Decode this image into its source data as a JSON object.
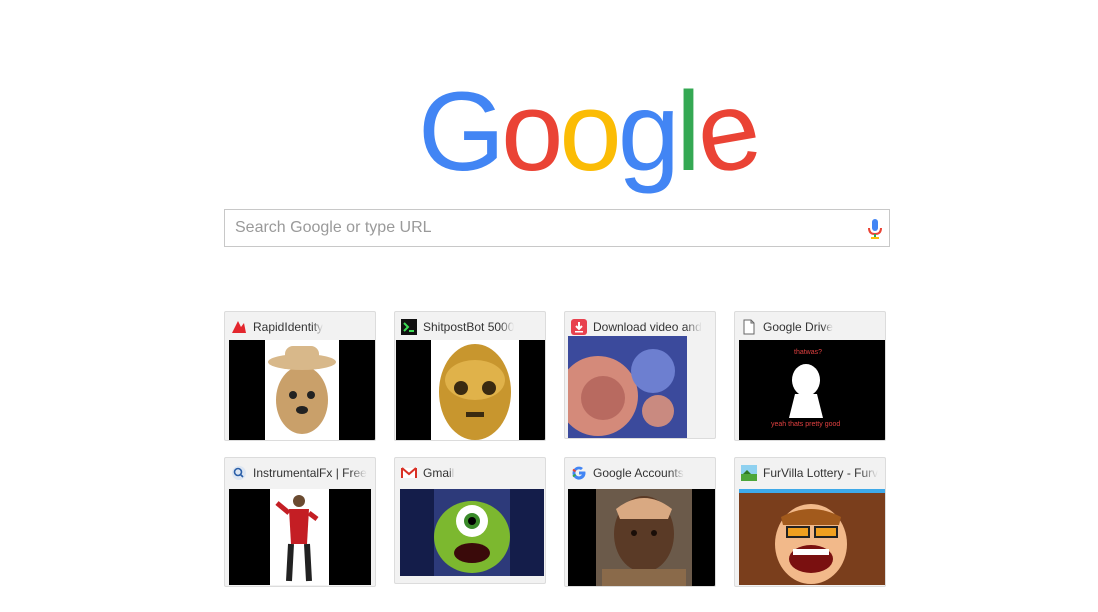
{
  "logo": {
    "letters": [
      "G",
      "o",
      "o",
      "g",
      "l",
      "e"
    ],
    "colors": [
      "#4285F4",
      "#EA4335",
      "#FBBC05",
      "#4285F4",
      "#34A853",
      "#EA4335"
    ]
  },
  "search": {
    "placeholder": "Search Google or type URL",
    "value": "",
    "mic_icon": "microphone-icon"
  },
  "tiles": [
    {
      "title": "RapidIdentity",
      "favicon": "rapididentity-favicon-icon",
      "thumbnail": "dog-in-cowboy-hat"
    },
    {
      "title": "ShitpostBot 5000",
      "favicon": "terminal-favicon-icon",
      "thumbnail": "gold-robot-face"
    },
    {
      "title": "Download video and",
      "favicon": "download-favicon-icon",
      "thumbnail": "distorted-face"
    },
    {
      "title": "Google Drive",
      "favicon": "document-favicon-icon",
      "thumbnail": "rage-comic"
    },
    {
      "title": "InstrumentalFx | Free",
      "favicon": "search-favicon-icon",
      "thumbnail": "dancing-man-red-jacket"
    },
    {
      "title": "Gmail",
      "favicon": "gmail-favicon-icon",
      "thumbnail": "green-one-eyed-monster"
    },
    {
      "title": "Google Accounts",
      "favicon": "google-g-favicon-icon",
      "thumbnail": "bald-man-portrait"
    },
    {
      "title": "FurVilla Lottery - Furv",
      "favicon": "landscape-favicon-icon",
      "thumbnail": "cartoon-man-laughing"
    }
  ],
  "rage_comic_text": {
    "top": "thatwas?",
    "bottom": "yeah thats pretty good"
  }
}
